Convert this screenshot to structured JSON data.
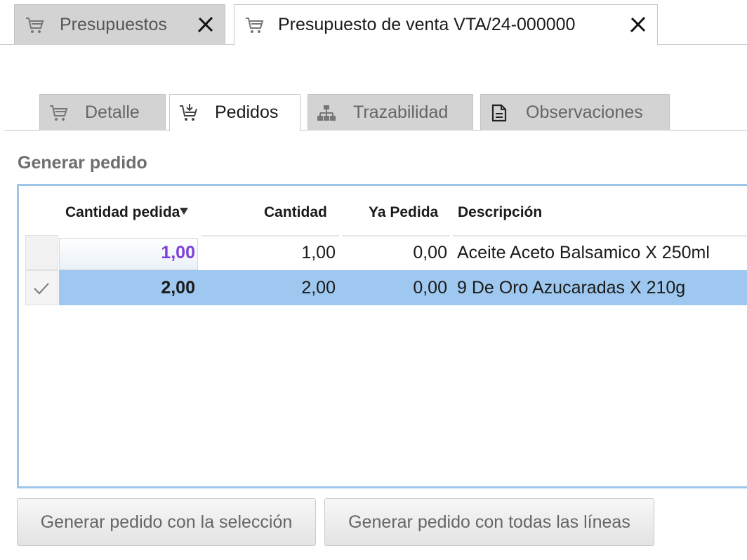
{
  "doc_tabs": [
    {
      "label": "Presupuestos",
      "icon": "cart-icon"
    },
    {
      "label": "Presupuesto de venta VTA/24-000000",
      "icon": "cart-icon"
    }
  ],
  "sub_tabs": [
    {
      "label": "Detalle",
      "icon": "cart-icon"
    },
    {
      "label": "Pedidos",
      "icon": "cart-download-icon"
    },
    {
      "label": "Trazabilidad",
      "icon": "hierarchy-icon"
    },
    {
      "label": "Observaciones",
      "icon": "document-icon"
    }
  ],
  "section": {
    "title": "Generar pedido"
  },
  "table": {
    "columns": [
      "Cantidad pedida",
      "Cantidad",
      "Ya Pedida",
      "Descripción"
    ],
    "rows": [
      {
        "cantidad_pedida": "1,00",
        "cantidad": "1,00",
        "ya_pedida": "0,00",
        "descripcion": "Aceite Aceto Balsamico X 250ml",
        "checked": false
      },
      {
        "cantidad_pedida": "2,00",
        "cantidad": "2,00",
        "ya_pedida": "0,00",
        "descripcion": "9 De Oro Azucaradas X 210g",
        "checked": true
      }
    ]
  },
  "buttons": {
    "generate_selection": "Generar pedido con la selección",
    "generate_all": "Generar pedido con todas las líneas"
  },
  "colors": {
    "selected_row": "#9fc8f0",
    "edited_value": "#7e3fd6",
    "panel_border": "#9fc5e8"
  }
}
